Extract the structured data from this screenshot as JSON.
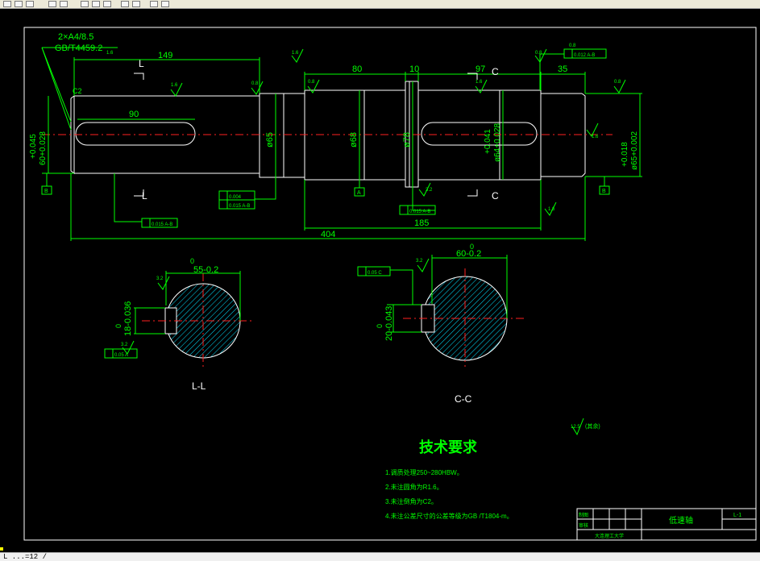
{
  "statusbar": {
    "text": "L ...=12 /"
  },
  "colors": {
    "background": "#000000",
    "dimension": "#00ff00",
    "outline": "#ffffff",
    "centerline": "#ff2020",
    "hatch": "#00e0ff"
  },
  "drawing": {
    "spline_note_1": "2×A4/8.5",
    "spline_note_2": "GB/T4459.2",
    "spline_note_sub": "1.6",
    "dim_149": "149",
    "dim_80": "80",
    "dim_10": "10",
    "dim_97": "97",
    "dim_35": "35",
    "dim_90": "90",
    "dim_185": "185",
    "dim_404": "404",
    "chamfer_c2": "C2",
    "section_l": "L",
    "section_c": "C",
    "dia_left_tol_up": "+0.045",
    "dia_left_tol_low": "60+0.028",
    "dia_65": "ø65",
    "dia_68": "ø68",
    "dia_78": "ø78",
    "dia_mid_tol_up": "+0.041",
    "dia_mid_tol_low": "ø64+0.028",
    "dia_right_tol_up": "+0.018",
    "dia_right_tol_low": "ø65+0.002",
    "rough_16": "1.6",
    "rough_08": "0.8",
    "rough_32": "3.2",
    "datum_b": "B",
    "datum_a": "A",
    "tol_box_1": "0.015 A-B",
    "tol_box_2a": "0.004",
    "tol_box_2b": "0.015 A-B",
    "tol_box_3": "0.015 A-B",
    "tol_box_top": "0.012 A-B",
    "tol_box_top_label": "0.8",
    "sec_l_top_tol": "0",
    "sec_l_top": "55-0.2",
    "sec_l_side_tol": "0",
    "sec_l_side": "18-0.036",
    "sec_l_box": "0.05 A",
    "sec_l_label": "L-L",
    "sec_c_top_tol": "0",
    "sec_c_top": "60-0.2",
    "sec_c_side_tol": "0",
    "sec_c_side": "20-0.043",
    "sec_c_box": "0.05 C",
    "sec_c_label": "C-C",
    "rough_rest": "12.5",
    "rough_rest_label": "(其余)"
  },
  "tech": {
    "title": "技术要求",
    "items": [
      "1.调质处理250~280HBW。",
      "2.未注圆角为R1.6。",
      "3.未注倒角为C2。",
      "4.未注公差尺寸的公差等级为GB /T1804-m。"
    ]
  },
  "titleblock": {
    "draw_label": "制图",
    "check_label": "审核",
    "part_name": "低速轴",
    "drawing_no": "L-1",
    "school": "大连理工大学"
  }
}
